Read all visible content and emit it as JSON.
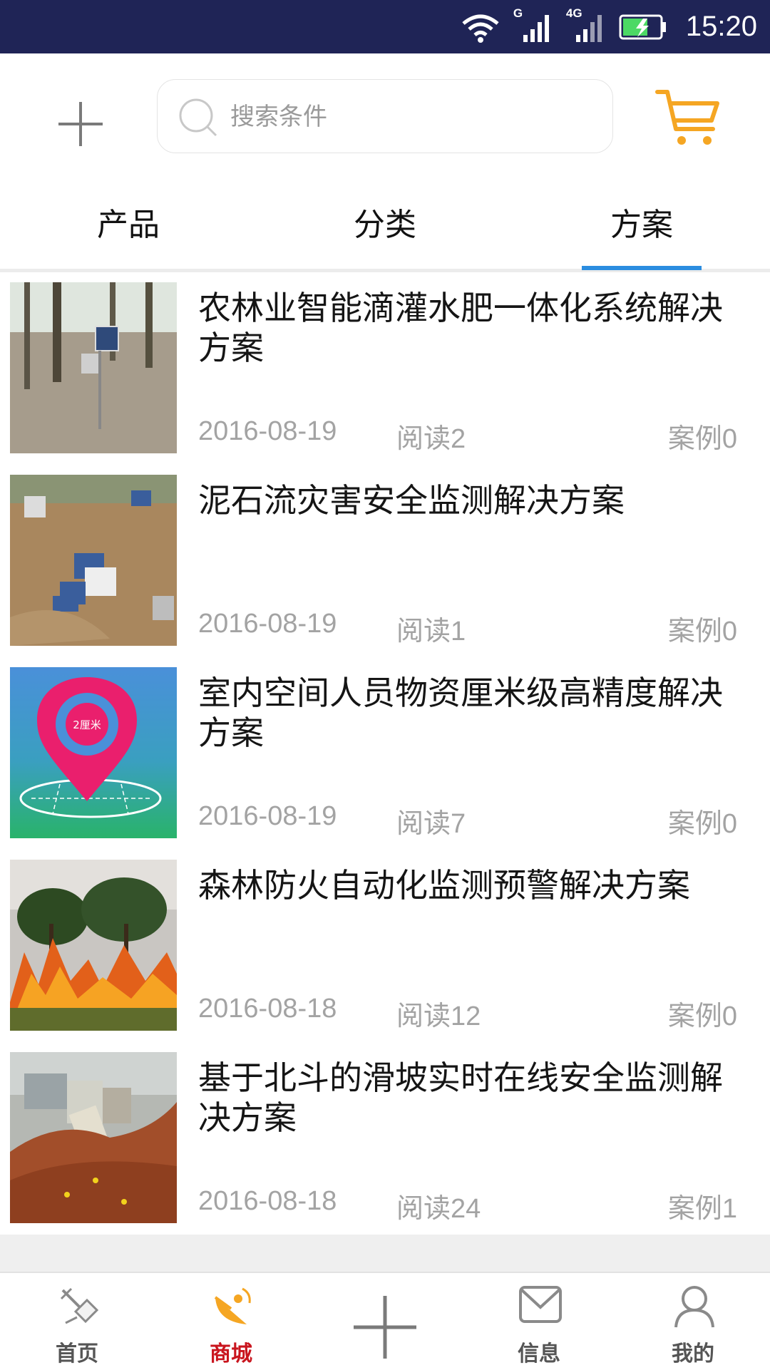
{
  "status_bar": {
    "time": "15:20",
    "network_1": "G",
    "network_2": "4G"
  },
  "header": {
    "search_placeholder": "搜索条件"
  },
  "tabs": [
    {
      "label": "产品",
      "active": false
    },
    {
      "label": "分类",
      "active": false
    },
    {
      "label": "方案",
      "active": true
    }
  ],
  "solutions": [
    {
      "title": "农林业智能滴灌水肥一体化系统解决方案",
      "date": "2016-08-19",
      "reads": "阅读2",
      "cases": "案例0"
    },
    {
      "title": "泥石流灾害安全监测解决方案",
      "date": "2016-08-19",
      "reads": "阅读1",
      "cases": "案例0"
    },
    {
      "title": "室内空间人员物资厘米级高精度解决方案",
      "date": "2016-08-19",
      "reads": "阅读7",
      "cases": "案例0",
      "thumb_text": "2厘米"
    },
    {
      "title": "森林防火自动化监测预警解决方案",
      "date": "2016-08-18",
      "reads": "阅读12",
      "cases": "案例0"
    },
    {
      "title": "基于北斗的滑坡实时在线安全监测解决方案",
      "date": "2016-08-18",
      "reads": "阅读24",
      "cases": "案例1"
    }
  ],
  "bottom_nav": [
    {
      "label": "首页",
      "icon": "satellite-icon"
    },
    {
      "label": "商城",
      "icon": "dish-icon",
      "active": true
    },
    {
      "label": "",
      "icon": "plus-icon"
    },
    {
      "label": "信息",
      "icon": "mail-icon"
    },
    {
      "label": "我的",
      "icon": "user-icon"
    }
  ],
  "colors": {
    "accent": "#2b8de0",
    "status_bar": "#1f2456",
    "cart": "#f5a623",
    "active_nav": "#c9151e"
  }
}
